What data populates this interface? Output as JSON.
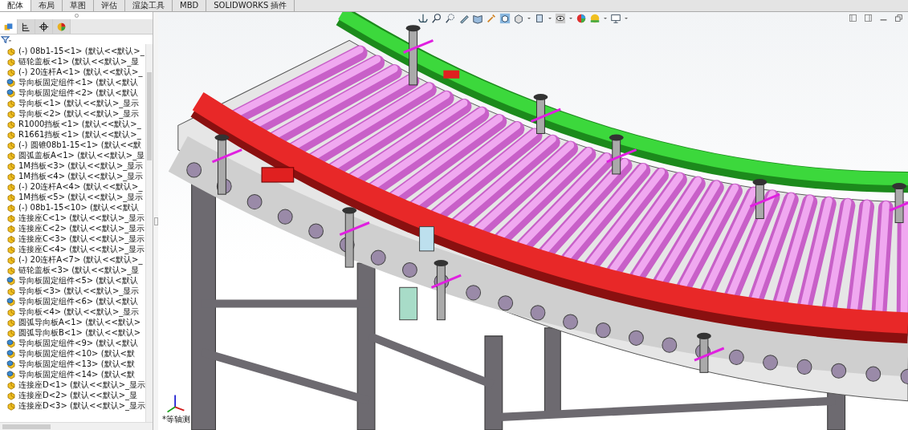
{
  "command_tabs": [
    {
      "label": "配体",
      "selected": true
    },
    {
      "label": "布局",
      "selected": false
    },
    {
      "label": "草图",
      "selected": false
    },
    {
      "label": "评估",
      "selected": false
    },
    {
      "label": "渲染工具",
      "selected": false
    },
    {
      "label": "MBD",
      "selected": false
    },
    {
      "label": "SOLIDWORKS 插件",
      "selected": false
    }
  ],
  "panel_tabs": [
    {
      "kind": "feature",
      "selected": true
    },
    {
      "kind": "property",
      "selected": false
    },
    {
      "kind": "config",
      "selected": false
    },
    {
      "kind": "display",
      "selected": false
    }
  ],
  "tree": [
    {
      "kind": "part",
      "label": "(-) 08b1-15<1> (默认<<默认>_"
    },
    {
      "kind": "part",
      "label": "链轮盖板<1> (默认<<默认>_显"
    },
    {
      "kind": "part",
      "label": "(-) 20连杆A<1> (默认<<默认>_"
    },
    {
      "kind": "assembly",
      "label": "导向板固定组件<1> (默认<默认"
    },
    {
      "kind": "assembly",
      "label": "导向板固定组件<2> (默认<默认"
    },
    {
      "kind": "part",
      "label": "导向板<1> (默认<<默认>_显示"
    },
    {
      "kind": "part",
      "label": "导向板<2> (默认<<默认>_显示"
    },
    {
      "kind": "part",
      "label": "R1000挡板<1> (默认<<默认>_"
    },
    {
      "kind": "part",
      "label": "R1661挡板<1> (默认<<默认>_"
    },
    {
      "kind": "part",
      "label": "(-) 圆锥08b1-15<1> (默认<<默"
    },
    {
      "kind": "part",
      "label": "圆弧盖板A<1> (默认<<默认>_显"
    },
    {
      "kind": "part",
      "label": "1M挡板<3> (默认<<默认>_显示"
    },
    {
      "kind": "part",
      "label": "1M挡板<4> (默认<<默认>_显示"
    },
    {
      "kind": "part",
      "label": "(-) 20连杆A<4> (默认<<默认>_"
    },
    {
      "kind": "part",
      "label": "1M挡板<5> (默认<<默认>_显示"
    },
    {
      "kind": "part",
      "label": "(-) 08b1-15<10> (默认<<默认"
    },
    {
      "kind": "part",
      "label": "连接座C<1> (默认<<默认>_显示"
    },
    {
      "kind": "part",
      "label": "连接座C<2> (默认<<默认>_显示"
    },
    {
      "kind": "part",
      "label": "连接座C<3> (默认<<默认>_显示"
    },
    {
      "kind": "part",
      "label": "连接座C<4> (默认<<默认>_显示"
    },
    {
      "kind": "part",
      "label": "(-) 20连杆A<7> (默认<<默认>_"
    },
    {
      "kind": "part",
      "label": "链轮盖板<3> (默认<<默认>_显"
    },
    {
      "kind": "assembly",
      "label": "导向板固定组件<5> (默认<默认"
    },
    {
      "kind": "part",
      "label": "导向板<3> (默认<<默认>_显示"
    },
    {
      "kind": "assembly",
      "label": "导向板固定组件<6> (默认<默认"
    },
    {
      "kind": "part",
      "label": "导向板<4> (默认<<默认>_显示"
    },
    {
      "kind": "part",
      "label": "圆弧导向板A<1> (默认<<默认>"
    },
    {
      "kind": "part",
      "label": "圆弧导向板B<1> (默认<<默认>"
    },
    {
      "kind": "assembly",
      "label": "导向板固定组件<9> (默认<默认"
    },
    {
      "kind": "assembly",
      "label": "导向板固定组件<10> (默认<默"
    },
    {
      "kind": "assembly",
      "label": "导向板固定组件<13> (默认<默"
    },
    {
      "kind": "assembly",
      "label": "导向板固定组件<14> (默认<默"
    },
    {
      "kind": "part",
      "label": "连接座D<1> (默认<<默认>_显示"
    },
    {
      "kind": "part",
      "label": "连接座D<2> (默认<<默认>_显"
    },
    {
      "kind": "part",
      "label": "连接座D<3> (默认<<默认>_显示"
    }
  ],
  "view_label": "*等轴测"
}
